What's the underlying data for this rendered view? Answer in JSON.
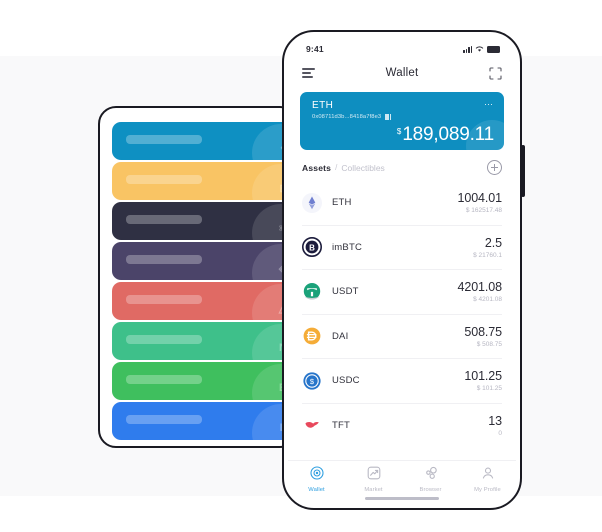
{
  "background": {
    "top_band_color": "#ffffff",
    "mid_band_color": "#f9f9fa",
    "bottom_band_color": "#ffffff"
  },
  "left_panel": {
    "name": "coin-card-stack",
    "cards": [
      {
        "color": "#0e90c2",
        "glyph": "♦",
        "icon_name": "ethereum-diamond-icon"
      },
      {
        "color": "#f9c464",
        "glyph": "฿",
        "icon_name": "bitcoin-b-icon"
      },
      {
        "color": "#2f3043",
        "glyph": "⚛",
        "icon_name": "cosmos-atom-icon"
      },
      {
        "color": "#4b4469",
        "glyph": "◈",
        "icon_name": "eos-drop-icon"
      },
      {
        "color": "#e06a64",
        "glyph": "△",
        "icon_name": "tron-triangle-icon"
      },
      {
        "color": "#3ec08a",
        "glyph": "N",
        "icon_name": "neo-n-icon"
      },
      {
        "color": "#3fbf5e",
        "glyph": "B",
        "icon_name": "bch-b-icon"
      },
      {
        "color": "#2f7ced",
        "glyph": "L",
        "icon_name": "litecoin-l-icon"
      }
    ]
  },
  "phone": {
    "status_bar": {
      "time": "9:41",
      "signal_icon": "cellular-signal-icon",
      "wifi_icon": "wifi-icon",
      "battery_icon": "battery-icon"
    },
    "nav_bar": {
      "menu_icon": "menu-lines-icon",
      "title": "Wallet",
      "scan_icon": "scan-frame-icon"
    },
    "wallet_card": {
      "name": "ETH",
      "address": "0x08711d3b...8418a7f8e3",
      "copy_icon": "qr-code-icon",
      "more_icon": "more-dots-icon",
      "currency_symbol": "$",
      "balance": "189,089.11",
      "background_color": "#0e8ec0"
    },
    "assets_header": {
      "assets_label": "Assets",
      "separator": "/",
      "collectibles_label": "Collectibles",
      "add_icon": "plus-circle-icon"
    },
    "assets": [
      {
        "symbol": "ETH",
        "amount": "1004.01",
        "fiat": "$ 162517.48",
        "icon": "ethereum-icon",
        "icon_color": "#6f7fd0",
        "icon_bg": "#f4f5fb"
      },
      {
        "symbol": "imBTC",
        "amount": "2.5",
        "fiat": "$ 21760.1",
        "icon": "imbtc-icon",
        "icon_color": "#1c1c3c",
        "icon_bg": "#ffffff"
      },
      {
        "symbol": "USDT",
        "amount": "4201.08",
        "fiat": "$ 4201.08",
        "icon": "tether-icon",
        "icon_color": "#1ba27a",
        "icon_bg": "#ffffff"
      },
      {
        "symbol": "DAI",
        "amount": "508.75",
        "fiat": "$ 508.75",
        "icon": "dai-icon",
        "icon_color": "#f5ac37",
        "icon_bg": "#ffffff"
      },
      {
        "symbol": "USDC",
        "amount": "101.25",
        "fiat": "$ 101.25",
        "icon": "usdc-icon",
        "icon_color": "#2775ca",
        "icon_bg": "#ffffff"
      },
      {
        "symbol": "TFT",
        "amount": "13",
        "fiat": "0",
        "icon": "tft-bird-icon",
        "icon_color": "#e8485c",
        "icon_bg": "#ffffff"
      }
    ],
    "tab_bar": {
      "active_color": "#2f9fe0",
      "inactive_color": "#b9b9c4",
      "items": [
        {
          "label": "Wallet",
          "icon": "wallet-target-icon",
          "active": true
        },
        {
          "label": "Market",
          "icon": "market-chart-icon",
          "active": false
        },
        {
          "label": "Browser",
          "icon": "browser-nodes-icon",
          "active": false
        },
        {
          "label": "My Profile",
          "icon": "profile-person-icon",
          "active": false
        }
      ]
    }
  }
}
